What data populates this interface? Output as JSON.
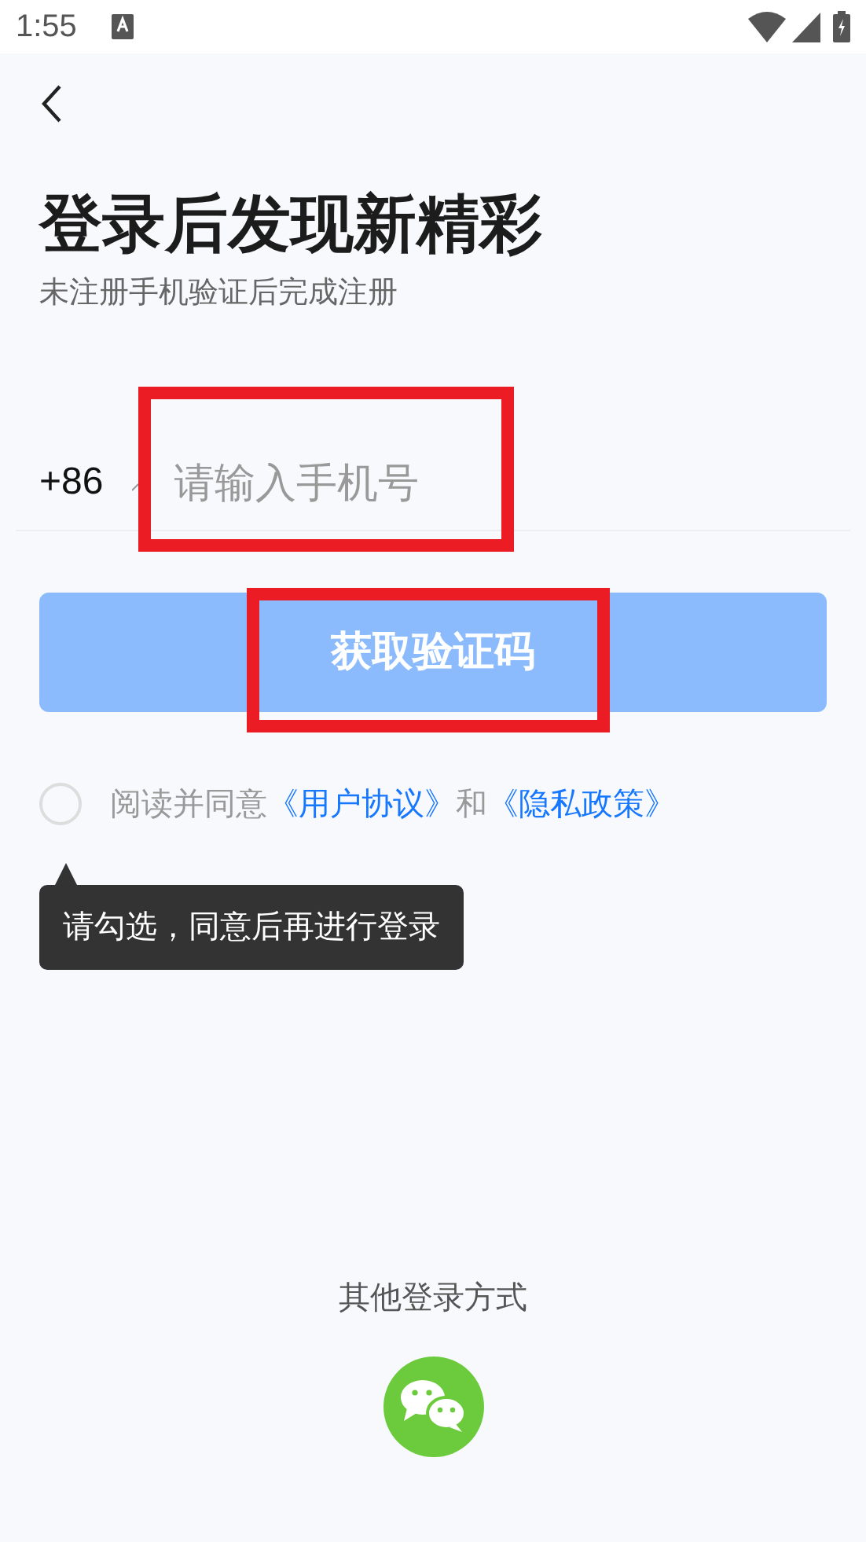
{
  "status_bar": {
    "time": "1:55"
  },
  "title": "登录后发现新精彩",
  "subtitle": "未注册手机验证后完成注册",
  "phone": {
    "country_code": "+86",
    "placeholder": "请输入手机号",
    "highlighted": true
  },
  "get_code_button": {
    "label": "获取验证码",
    "disabled": true,
    "highlighted": true
  },
  "agreement": {
    "checked": false,
    "parts": [
      {
        "kind": "text",
        "text": "阅读并同意"
      },
      {
        "kind": "link",
        "text": "《用户协议》"
      },
      {
        "kind": "text",
        "text": "和"
      },
      {
        "kind": "link",
        "text": "《隐私政策》"
      }
    ]
  },
  "tooltip": "请勾选，同意后再进行登录",
  "other_login": {
    "label": "其他登录方式"
  }
}
